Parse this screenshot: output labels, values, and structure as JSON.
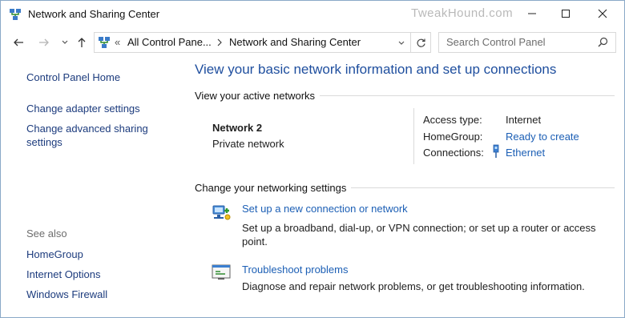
{
  "window": {
    "title": "Network and Sharing Center",
    "watermark": "TweakHound.com",
    "icon": "network-center-icon"
  },
  "address": {
    "overflow": "«",
    "crumbs": [
      "All Control Pane...",
      "Network and Sharing Center"
    ],
    "search_placeholder": "Search Control Panel"
  },
  "sidebar": {
    "items": [
      {
        "label": "Control Panel Home"
      },
      {
        "label": "Change adapter settings"
      },
      {
        "label": "Change advanced sharing settings"
      }
    ],
    "see_also_label": "See also",
    "see_also": [
      {
        "label": "HomeGroup"
      },
      {
        "label": "Internet Options"
      },
      {
        "label": "Windows Firewall"
      }
    ]
  },
  "main": {
    "heading": "View your basic network information and set up connections",
    "active_networks_label": "View your active networks",
    "network": {
      "name": "Network  2",
      "type": "Private network",
      "access_type_label": "Access type:",
      "access_type_value": "Internet",
      "homegroup_label": "HomeGroup:",
      "homegroup_value": "Ready to create",
      "connections_label": "Connections:",
      "connections_value": "Ethernet"
    },
    "change_settings_label": "Change your networking settings",
    "tasks": [
      {
        "title": "Set up a new connection or network",
        "description": "Set up a broadband, dial-up, or VPN connection; or set up a router or access point.",
        "icon": "new-connection-icon"
      },
      {
        "title": "Troubleshoot problems",
        "description": "Diagnose and repair network problems, or get troubleshooting information.",
        "icon": "troubleshoot-icon"
      }
    ]
  },
  "colors": {
    "link": "#1c5fb5",
    "heading": "#1e4e9e",
    "sidebar_link": "#1c3b7d"
  }
}
